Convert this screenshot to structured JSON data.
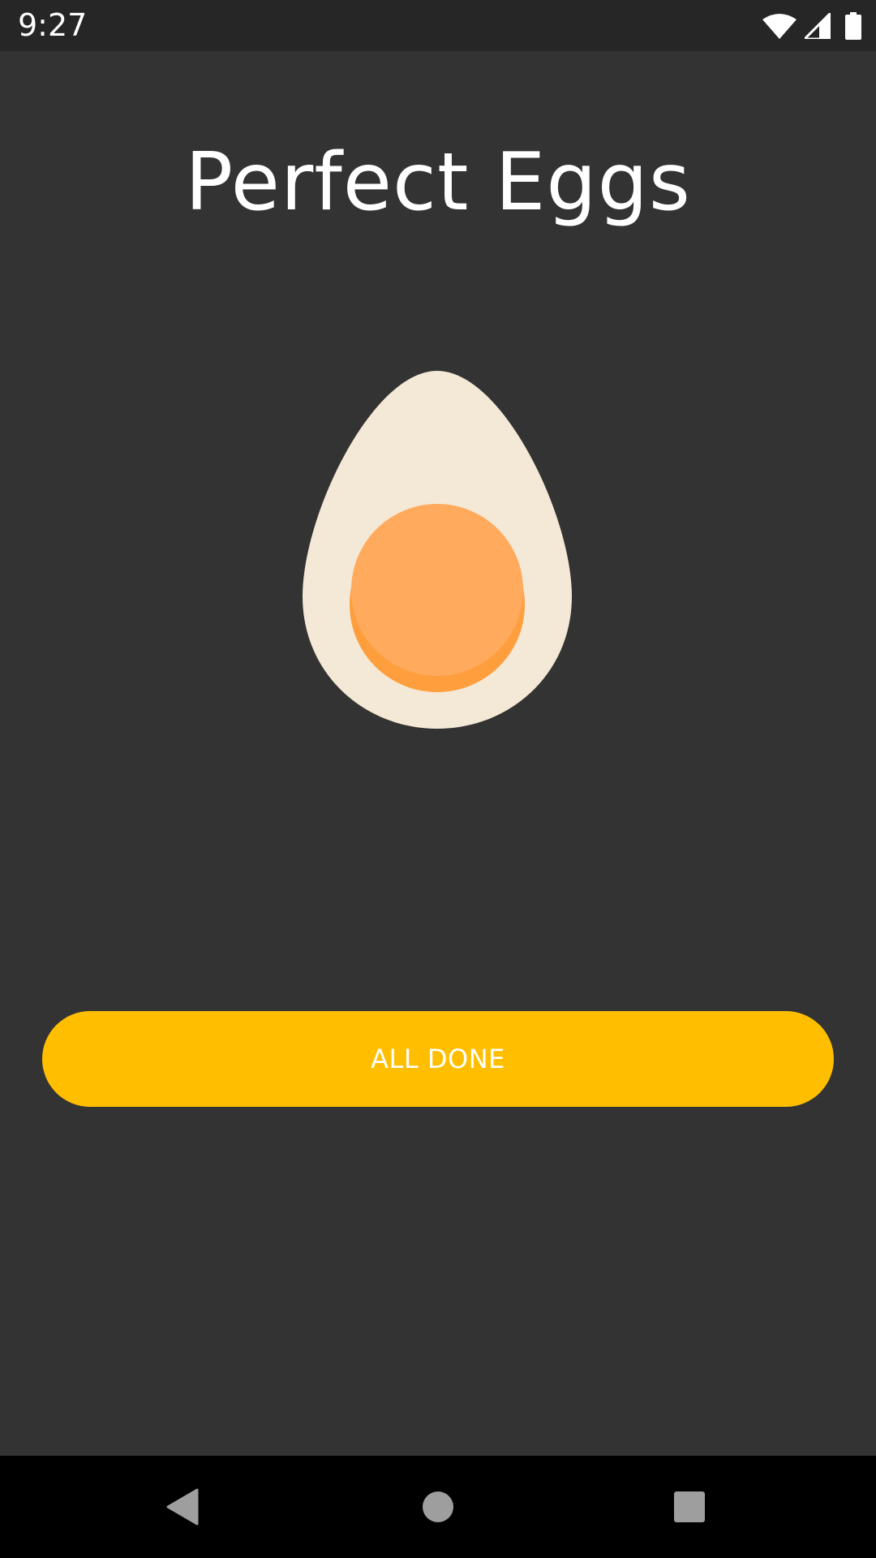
{
  "status_bar": {
    "time": "9:27",
    "icons": [
      "wifi-icon",
      "cell-signal-icon",
      "battery-icon"
    ]
  },
  "app": {
    "title": "Perfect Eggs",
    "illustration": "hard-boiled-egg",
    "button_label": "ALL DONE"
  },
  "nav_bar": {
    "buttons": [
      "back-icon",
      "home-icon",
      "recents-icon"
    ]
  },
  "colors": {
    "background": "#333333",
    "status_bar": "#262626",
    "accent": "#FFBF00",
    "egg_white": "#F4E9D6",
    "yolk": "#FFAA5C",
    "yolk_shadow": "#FF9E3D",
    "nav_bar": "#000000"
  }
}
